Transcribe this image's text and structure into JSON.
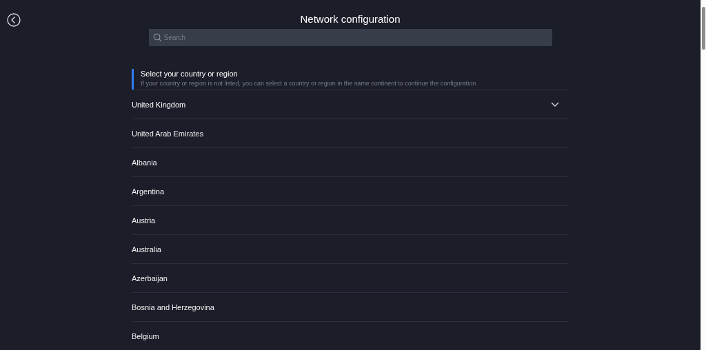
{
  "header": {
    "title": "Network configuration"
  },
  "search": {
    "placeholder": "Search"
  },
  "section": {
    "title": "Select your country or region",
    "hint": "If your country or region is not listed, you can select a country or region in the same continent to continue the configuration"
  },
  "countries": [
    {
      "name": "United Kingdom",
      "selected": true
    },
    {
      "name": "United Arab Emirates",
      "selected": false
    },
    {
      "name": "Albania",
      "selected": false
    },
    {
      "name": "Argentina",
      "selected": false
    },
    {
      "name": "Austria",
      "selected": false
    },
    {
      "name": "Australia",
      "selected": false
    },
    {
      "name": "Azerbaijan",
      "selected": false
    },
    {
      "name": "Bosnia and Herzegovina",
      "selected": false
    },
    {
      "name": "Belgium",
      "selected": false
    }
  ]
}
